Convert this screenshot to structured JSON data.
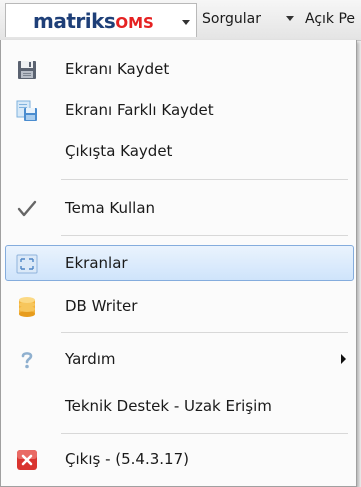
{
  "menubar": {
    "logo_part1": "matriks",
    "logo_part2": "OMS",
    "tab_sorgular": "Sorgular",
    "tab_acik": "Açık Pe"
  },
  "menu": {
    "items": [
      {
        "label": "Ekranı Kaydet",
        "icon": "floppy-disk-icon"
      },
      {
        "label": "Ekranı Farklı Kaydet",
        "icon": "save-as-icon"
      },
      {
        "label": "Çıkışta Kaydet",
        "icon": ""
      },
      {
        "label": "Tema Kullan",
        "icon": "checkmark-icon"
      },
      {
        "label": "Ekranlar",
        "icon": "screens-icon",
        "highlighted": true
      },
      {
        "label": "DB Writer",
        "icon": "database-icon"
      },
      {
        "label": "Yardım",
        "icon": "help-icon",
        "submenu": true
      },
      {
        "label": "Teknik Destek - Uzak Erişim",
        "icon": ""
      },
      {
        "label": "Çıkış - (5.4.3.17)",
        "icon": "exit-icon"
      }
    ]
  },
  "colors": {
    "logo_blue": "#1e3f78",
    "logo_red": "#e52222",
    "highlight_border": "#84acdd",
    "exit_red": "#d9342f"
  }
}
